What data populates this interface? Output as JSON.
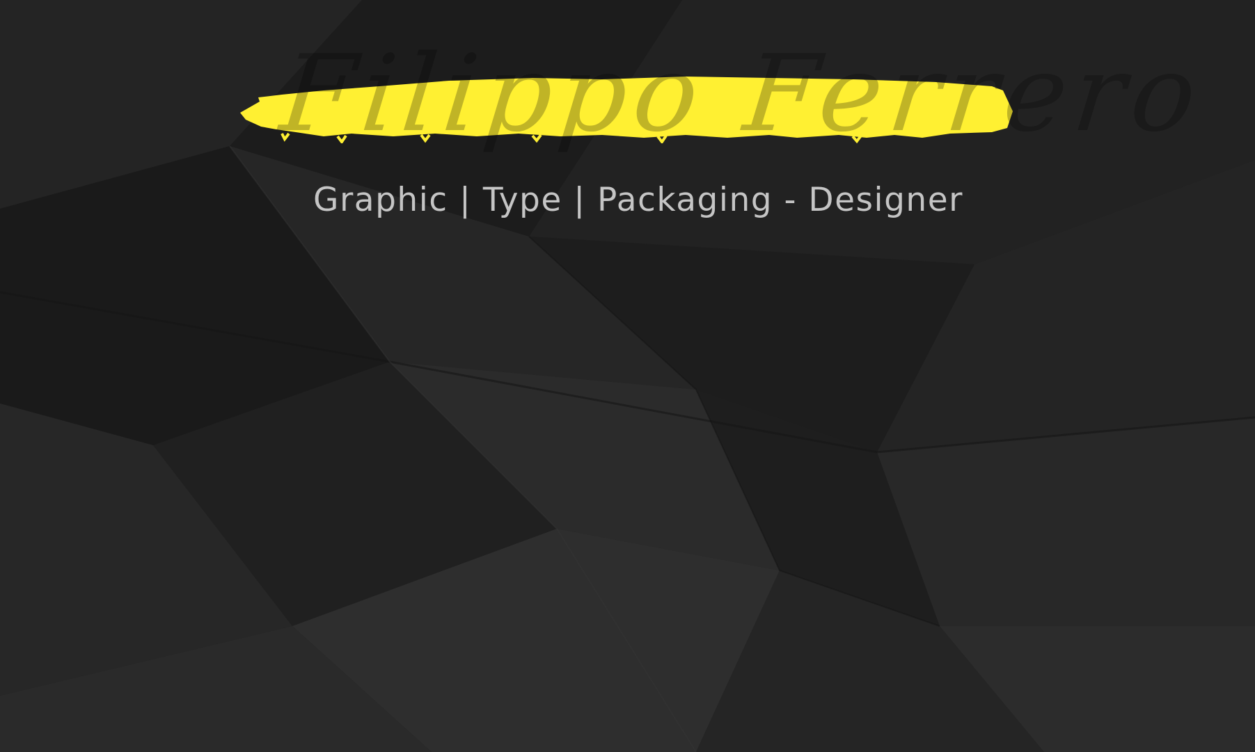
{
  "header": {
    "signature": "Filippo Ferrero",
    "tagline": "Graphic | Type | Packaging - Designer"
  },
  "colors": {
    "background": "#1f1f1f",
    "highlight": "#fff032",
    "text": "#c5c5c5"
  }
}
